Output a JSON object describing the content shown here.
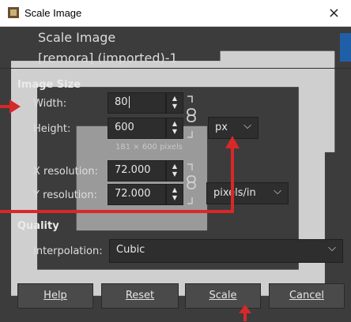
{
  "window": {
    "title": "Scale Image",
    "close_glyph": "×"
  },
  "header": {
    "title": "Scale Image",
    "subtitle": "[remora] (imported)-1"
  },
  "image_size": {
    "section_label": "Image Size",
    "width_label": "Width:",
    "width_value": "80",
    "height_label": "Height:",
    "height_value": "600",
    "pixel_note": "181 × 600 pixels",
    "unit_value": "px"
  },
  "resolution": {
    "x_label": "X resolution:",
    "x_value": "72.000",
    "y_label": "Y resolution:",
    "y_value": "72.000",
    "unit_value": "pixels/in"
  },
  "quality": {
    "section_label": "Quality",
    "interpolation_label": "Interpolation:",
    "interpolation_value": "Cubic"
  },
  "buttons": {
    "help": "Help",
    "reset": "Reset",
    "scale": "Scale",
    "cancel": "Cancel"
  },
  "colors": {
    "annotation": "#d7282a",
    "background": "#3c3c3c",
    "preview_accent": "#1f5fa8"
  }
}
